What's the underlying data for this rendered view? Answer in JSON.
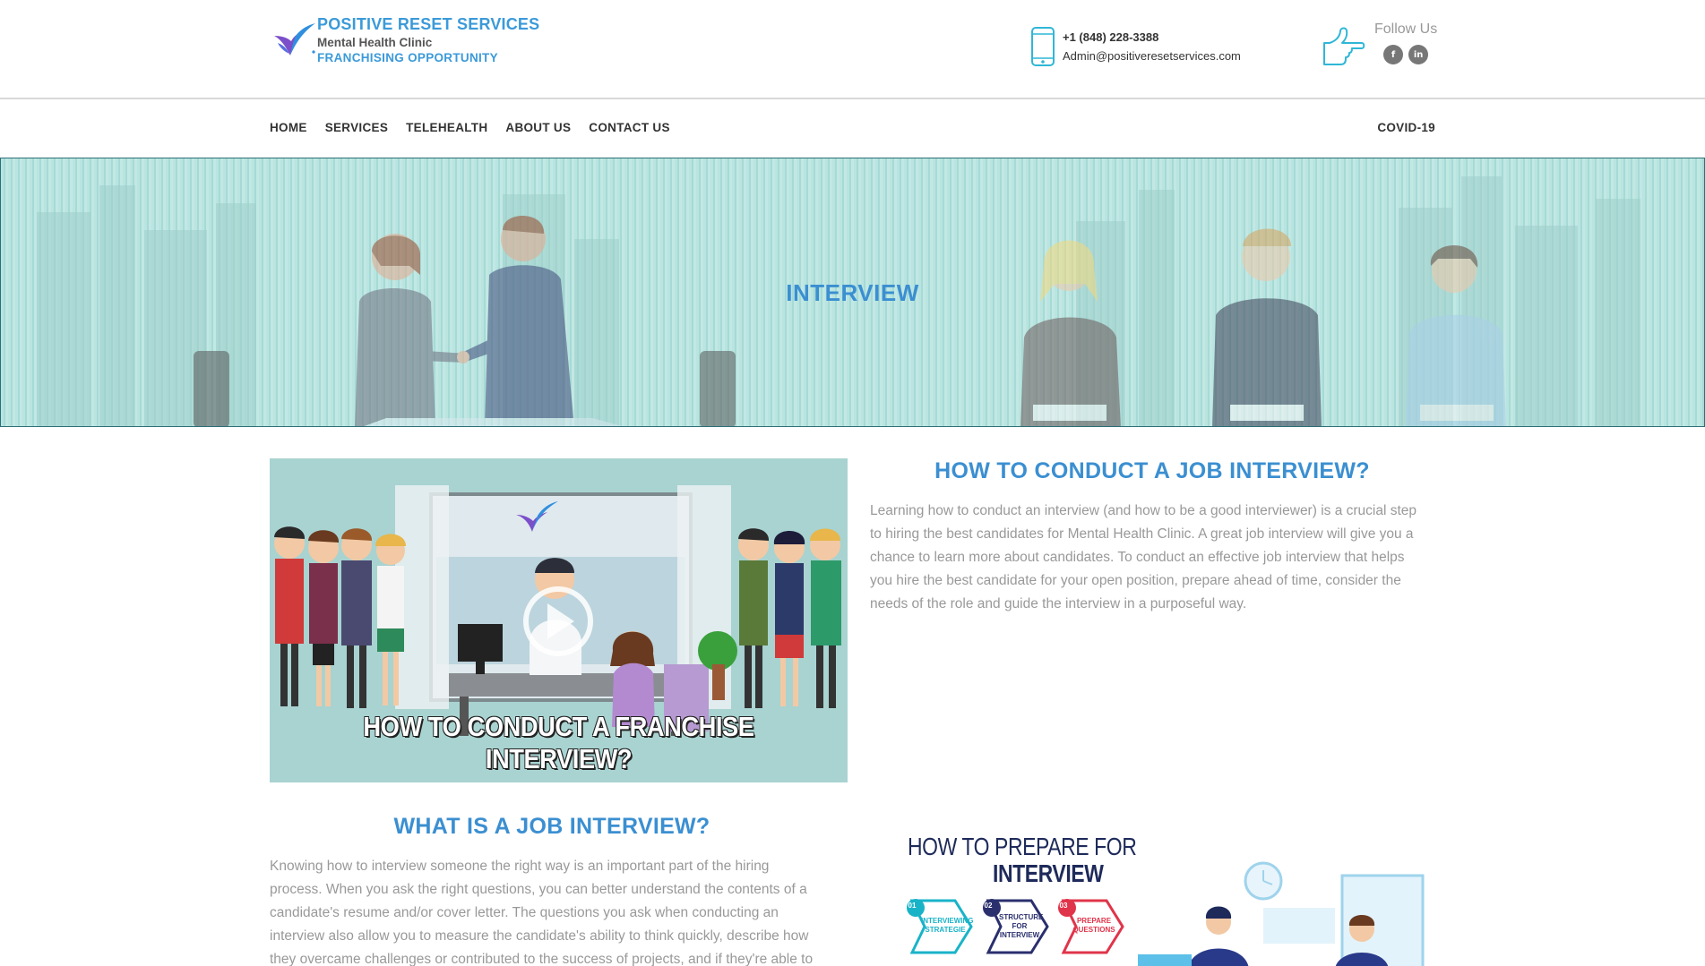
{
  "header": {
    "brand_title": "POSITIVE RESET SERVICES",
    "brand_subtitle": "Mental Health Clinic",
    "brand_tagline": "FRANCHISING OPPORTUNITY",
    "phone": "+1 (848) 228-3388",
    "email": "Admin@positiveresetservices.com",
    "follow_label": "Follow Us",
    "socials": [
      {
        "icon": "facebook-icon",
        "glyph": "f"
      },
      {
        "icon": "linkedin-icon",
        "glyph": "in"
      }
    ]
  },
  "nav": {
    "items": [
      "HOME",
      "SERVICES",
      "TELEHEALTH",
      "ABOUT US",
      "CONTACT US"
    ],
    "right_item": "COVID-19"
  },
  "hero": {
    "title": "INTERVIEW"
  },
  "video": {
    "caption": "HOW TO CONDUCT A FRANCHISE INTERVIEW?"
  },
  "section_conduct": {
    "heading": "HOW TO CONDUCT A JOB INTERVIEW?",
    "lines": [
      "Learning how to conduct an interview (and how to be a good interviewer) is a crucial step",
      "to hiring the best candidates for Mental Health Clinic. A great job interview will give you a",
      "chance to learn more about candidates. To conduct an effective job interview that helps",
      "you hire the best candidate for your open position, prepare ahead of time, consider the",
      "needs of the role and guide the interview in a purposeful way."
    ]
  },
  "section_what": {
    "heading": "WHAT IS A JOB INTERVIEW?",
    "lines": [
      "Knowing how to interview someone the right way is an important part of the hiring",
      "process. When you ask the right questions, you can better understand the contents of a",
      "candidate's resume and/or cover letter. The questions you ask when conducting an",
      "interview also allow you to measure the candidate's ability to think quickly, describe how",
      "they overcame challenges or contributed to the success of projects, and if they're able to"
    ]
  },
  "prepare_graphic": {
    "title_line1": "HOW TO PREPARE FOR",
    "title_line2": "INTERVIEW",
    "steps": [
      {
        "num": "01",
        "label": "INTERVIEWING STRATEGIE",
        "color": "#19b3c8"
      },
      {
        "num": "02",
        "label": "STRUCTURE FOR INTERVIEW",
        "color": "#2a2f6e"
      },
      {
        "num": "03",
        "label": "PREPARE QUESTIONS",
        "color": "#e0344a"
      }
    ]
  },
  "colors": {
    "accent_blue": "#3b8fd1",
    "hero_teal": "#b9e4e0"
  }
}
